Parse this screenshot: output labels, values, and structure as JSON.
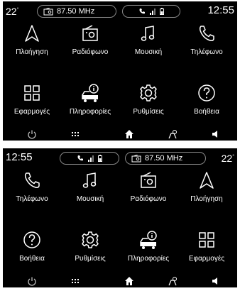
{
  "top": {
    "status": {
      "temp_value": "22",
      "temp_unit": "°",
      "radio": "87.50 MHz",
      "time": "12:55"
    },
    "apps": [
      {
        "id": "navigation",
        "label": "Πλοήγηση"
      },
      {
        "id": "radio",
        "label": "Ραδιόφωνο"
      },
      {
        "id": "music",
        "label": "Μουσική"
      },
      {
        "id": "phone",
        "label": "Τηλέφωνο"
      },
      {
        "id": "apps",
        "label": "Εφαρμογές"
      },
      {
        "id": "info",
        "label": "Πληροφορίες"
      },
      {
        "id": "settings",
        "label": "Ρυθμίσεις"
      },
      {
        "id": "help",
        "label": "Βοήθεια"
      }
    ]
  },
  "bottom": {
    "status": {
      "time": "12:55",
      "radio": "87.50 MHz",
      "temp_value": "22",
      "temp_unit": "°"
    },
    "apps": [
      {
        "id": "phone",
        "label": "Τηλέφωνο"
      },
      {
        "id": "music",
        "label": "Μουσική"
      },
      {
        "id": "radio",
        "label": "Ραδιόφωνο"
      },
      {
        "id": "navigation",
        "label": "Πλοήγηση"
      },
      {
        "id": "help",
        "label": "Βοήθεια"
      },
      {
        "id": "settings",
        "label": "Ρυθμίσεις"
      },
      {
        "id": "info",
        "label": "Πληροφορίες"
      },
      {
        "id": "apps",
        "label": "Εφαρμογές"
      }
    ]
  },
  "bottom_bar_icons": [
    "power-icon",
    "grid-dots-icon",
    "home-icon",
    "driving-eco-icon",
    "volume-icon"
  ],
  "colors": {
    "background": "#000000",
    "text": "#ffffff",
    "pill_border": "#888888"
  }
}
